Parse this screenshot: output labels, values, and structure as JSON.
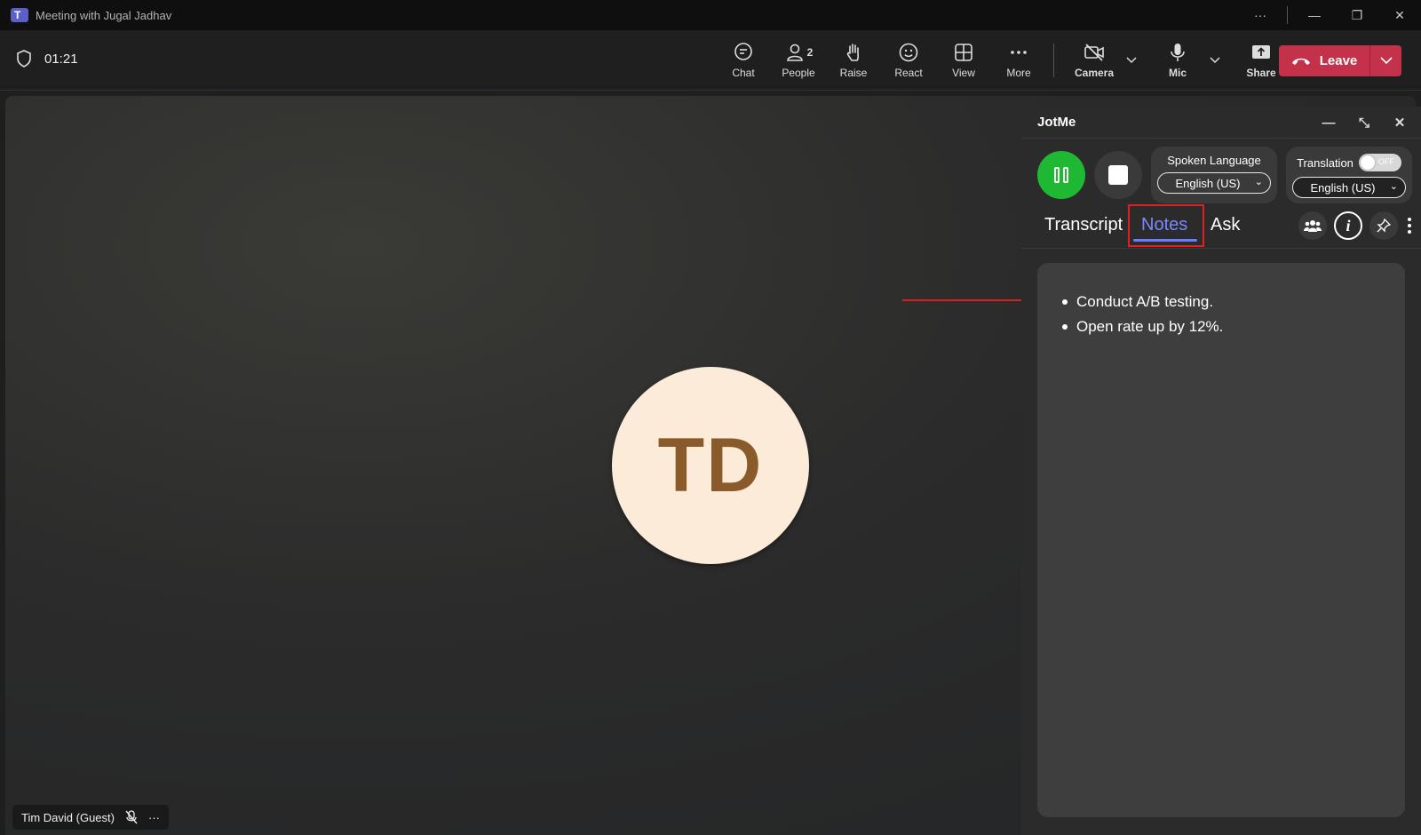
{
  "window": {
    "title": "Meeting with Jugal Jadhav"
  },
  "meeting": {
    "timer": "01:21",
    "toolbar": [
      {
        "label": "Chat",
        "icon": "chat-icon"
      },
      {
        "label": "People",
        "icon": "people-icon",
        "badge": "2"
      },
      {
        "label": "Raise",
        "icon": "raise-hand-icon"
      },
      {
        "label": "React",
        "icon": "react-icon"
      },
      {
        "label": "View",
        "icon": "view-icon"
      },
      {
        "label": "More",
        "icon": "more-icon"
      }
    ],
    "camera_label": "Camera",
    "mic_label": "Mic",
    "share_label": "Share",
    "leave_label": "Leave",
    "participant": {
      "initials": "TD",
      "name": "Tim David (Guest)"
    }
  },
  "jotme": {
    "title": "JotMe",
    "spoken_language": {
      "title": "Spoken Language",
      "value": "English (US)"
    },
    "translation": {
      "title": "Translation",
      "toggle_state": "OFF",
      "value": "English (US)"
    },
    "tabs": [
      "Transcript",
      "Notes",
      "Ask"
    ],
    "active_tab": "Notes",
    "notes": [
      "Conduct A/B testing.",
      "Open rate up by 12%."
    ]
  },
  "colors": {
    "accent_tab": "#7b86ff",
    "record_green": "#1eb833",
    "leave_red": "#c4314b",
    "highlight_red": "#e02020"
  }
}
